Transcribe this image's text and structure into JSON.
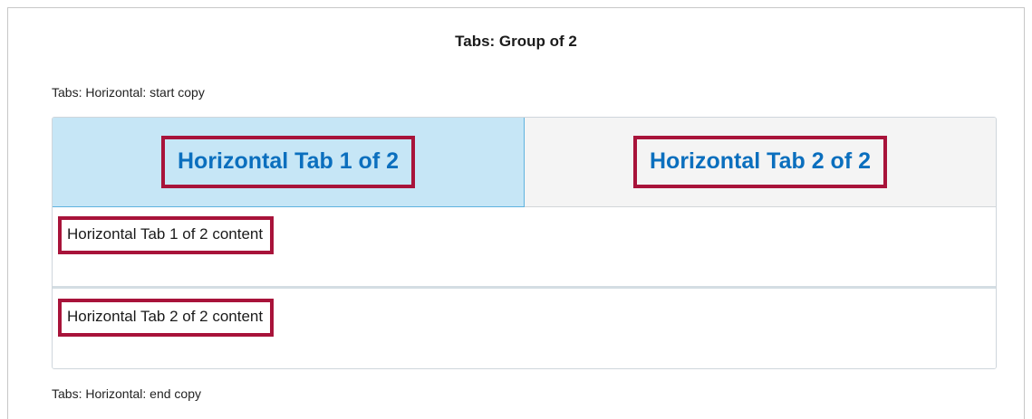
{
  "group": {
    "title": "Tabs: Group of 2",
    "start_copy": "Tabs: Horizontal: start copy",
    "end_copy": "Tabs: Horizontal: end copy"
  },
  "tabs": [
    {
      "label": "Horizontal Tab 1 of 2",
      "content": "Horizontal Tab 1 of 2 content",
      "selected": true
    },
    {
      "label": "Horizontal Tab 2 of 2",
      "content": "Horizontal Tab 2 of 2 content",
      "selected": false
    }
  ],
  "colors": {
    "active_tab_bg": "#c6e6f6",
    "inactive_tab_bg": "#f4f4f4",
    "tab_text": "#0b6fbe",
    "highlight_border": "#a8133a"
  }
}
